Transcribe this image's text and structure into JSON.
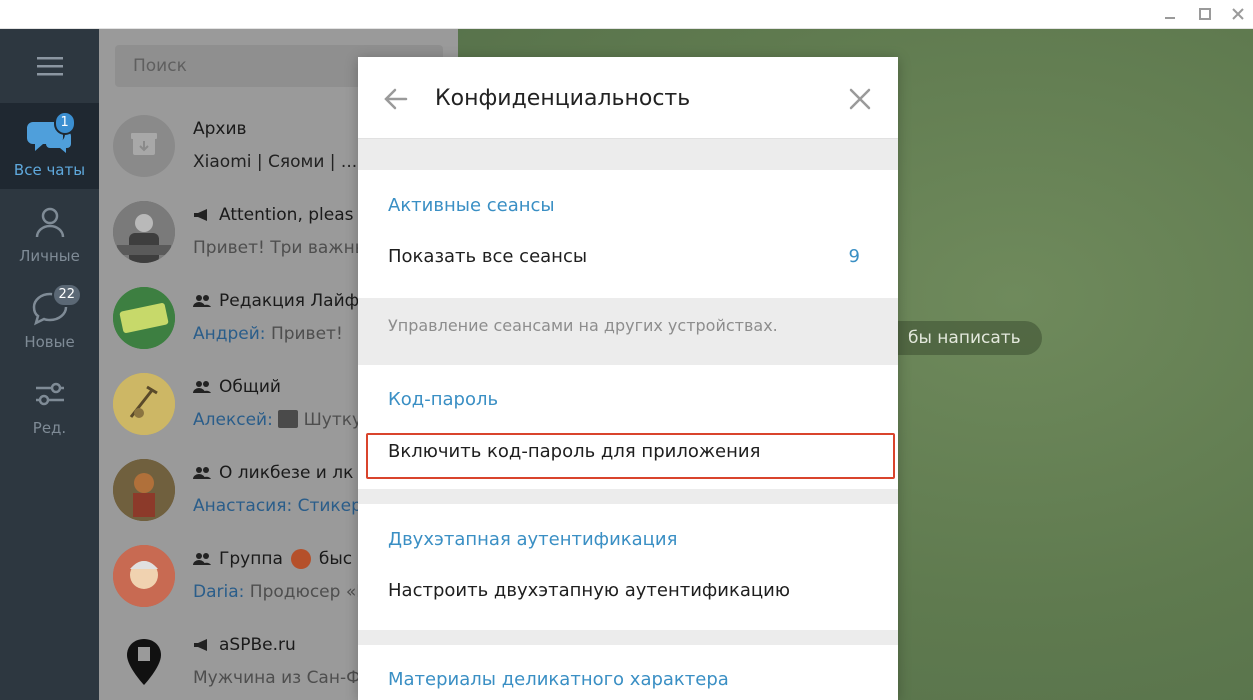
{
  "window": {
    "controls": [
      "minimize",
      "maximize",
      "close"
    ]
  },
  "rail": {
    "items": [
      {
        "label": "Все чаты",
        "badge": "1",
        "icon": "chats-icon"
      },
      {
        "label": "Личные",
        "badge": "",
        "icon": "person-icon"
      },
      {
        "label": "Новые",
        "badge": "22",
        "icon": "chat-bubble-icon"
      },
      {
        "label": "Ред.",
        "badge": "",
        "icon": "sliders-icon"
      }
    ]
  },
  "search": {
    "placeholder": "Поиск"
  },
  "chats": [
    {
      "name": "Архив",
      "sender": "",
      "preview": "Xiaomi | Сяоми | ..."
    },
    {
      "name": "Attention, pleas",
      "sender": "",
      "preview": "Привет! Три важны"
    },
    {
      "name": "Редакция Лайф",
      "sender": "Андрей:",
      "preview": "Привет!"
    },
    {
      "name": "Общий",
      "sender": "Алексей:",
      "preview": "Шутку"
    },
    {
      "name": "О ликбезе и лк",
      "sender": "Анастасия:",
      "preview": "Стикер"
    },
    {
      "name": "Группа",
      "name_tail": "быс",
      "sender": "Daria:",
      "preview": "Продюсер «Б"
    },
    {
      "name": "aSPBe.ru",
      "sender": "",
      "preview": "Мужчина из Сан-Ф"
    }
  ],
  "background_hint": "бы написать",
  "dialog": {
    "title": "Конфиденциальность",
    "sections": {
      "sessions": {
        "title": "Активные сеансы",
        "row_label": "Показать все сеансы",
        "row_value": "9",
        "hint": "Управление сеансами на других устройствах."
      },
      "passcode": {
        "title": "Код-пароль",
        "row_label": "Включить код-пароль для приложения"
      },
      "two_step": {
        "title": "Двухэтапная аутентификация",
        "row_label": "Настроить двухэтапную аутентификацию"
      },
      "sensitive": {
        "title": "Материалы деликатного характера"
      }
    }
  },
  "colors": {
    "accent": "#3a8fc4",
    "highlight": "#d9442c",
    "rail": "#2d3740"
  }
}
